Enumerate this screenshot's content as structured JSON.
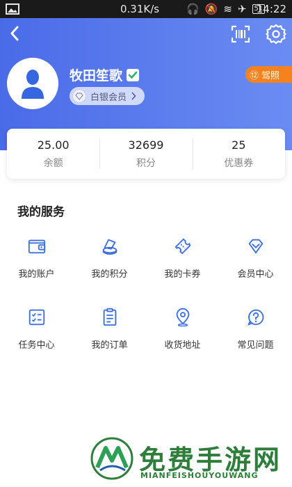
{
  "statusbar": {
    "speed": "0.31K/s",
    "battery": "51",
    "time": "14:22"
  },
  "header": {
    "back_icon": "chevron-left-icon",
    "scan_icon": "scan-icon",
    "settings_icon": "gear-icon"
  },
  "profile": {
    "name": "牧田笙歌",
    "member_level": "白银会员",
    "license_badge_num": "⑫",
    "license_badge": "驾照"
  },
  "stats": [
    {
      "value": "25.00",
      "label": "余额"
    },
    {
      "value": "32699",
      "label": "积分"
    },
    {
      "value": "25",
      "label": "优惠券"
    }
  ],
  "services": {
    "title": "我的服务",
    "items": [
      {
        "label": "我的账户",
        "icon": "wallet-icon"
      },
      {
        "label": "我的积分",
        "icon": "coins-icon"
      },
      {
        "label": "我的卡券",
        "icon": "ticket-icon"
      },
      {
        "label": "会员中心",
        "icon": "diamond-icon"
      },
      {
        "label": "任务中心",
        "icon": "task-list-icon"
      },
      {
        "label": "我的订单",
        "icon": "order-icon"
      },
      {
        "label": "收货地址",
        "icon": "location-icon"
      },
      {
        "label": "常见问题",
        "icon": "question-icon"
      }
    ]
  },
  "watermark": {
    "title": "免费手游网",
    "subtitle": "MIANFEISHOUYOUWANG"
  },
  "colors": {
    "accent": "#4a6be8",
    "icon": "#3d6fe0",
    "badge": "#f4831f"
  }
}
